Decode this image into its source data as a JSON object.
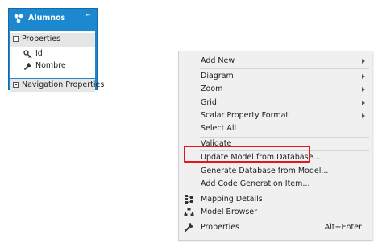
{
  "entity": {
    "title": "Alumnos",
    "sections": {
      "properties": "Properties",
      "navigation": "Navigation Properties"
    },
    "properties": [
      {
        "name": "Id",
        "icon": "key-icon"
      },
      {
        "name": "Nombre",
        "icon": "wrench-icon"
      }
    ],
    "colors": {
      "header": "#1c88cf",
      "section": "#e6e6e6"
    }
  },
  "context_menu": {
    "items": [
      {
        "label": "Add New",
        "submenu": true
      },
      {
        "label": "Diagram",
        "submenu": true
      },
      {
        "label": "Zoom",
        "submenu": true
      },
      {
        "label": "Grid",
        "submenu": true
      },
      {
        "label": "Scalar Property Format",
        "submenu": true
      },
      {
        "label": "Select All"
      },
      {
        "label": "Validate"
      },
      {
        "label": "Update Model from Database...",
        "highlighted": true
      },
      {
        "label": "Generate Database from Model..."
      },
      {
        "label": "Add Code Generation Item..."
      },
      {
        "label": "Mapping Details",
        "icon": "mapping-details-icon"
      },
      {
        "label": "Model Browser",
        "icon": "model-browser-icon"
      },
      {
        "label": "Properties",
        "icon": "wrench-icon",
        "shortcut": "Alt+Enter"
      }
    ],
    "highlight_color": "#e8141c"
  }
}
